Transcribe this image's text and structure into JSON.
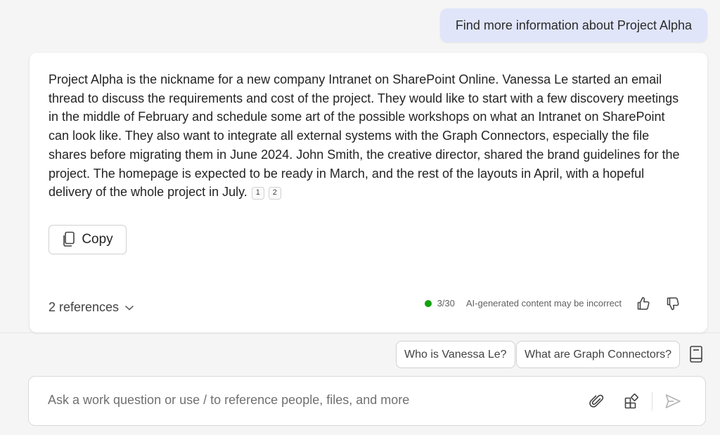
{
  "user_message": "Find more information about Project Alpha",
  "answer": {
    "text": "Project Alpha is the nickname for a new company Intranet on SharePoint Online. Vanessa Le started an email thread to discuss the requirements and cost of the project. They would like to start with a few discovery meetings in the middle of February and schedule some art of the possible workshops on what an Intranet on SharePoint can look like. They also want to integrate all external systems with the Graph Connectors, especially the file shares before migrating them in June 2024. John Smith, the creative director, shared the brand guidelines for the project. The homepage is expected to be ready in March, and the rest of the layouts in April, with a hopeful delivery of the whole project in July.",
    "citations": [
      "1",
      "2"
    ],
    "copy_label": "Copy",
    "references_label": "2 references",
    "response_count": "3/30",
    "disclaimer": "AI-generated content may be incorrect",
    "status_color": "#13a10e"
  },
  "suggestions": [
    "Who is Vanessa Le?",
    "What are Graph Connectors?"
  ],
  "input": {
    "placeholder": "Ask a work question or use / to reference people, files, and more",
    "value": ""
  },
  "icons": {
    "copy": "copy-icon",
    "chevron": "chevron-down-icon",
    "thumbs_up": "thumbs-up-icon",
    "thumbs_down": "thumbs-down-icon",
    "prompt_guide": "prompt-book-icon",
    "attach": "paperclip-icon",
    "apps": "apps-icon",
    "send": "send-icon"
  }
}
